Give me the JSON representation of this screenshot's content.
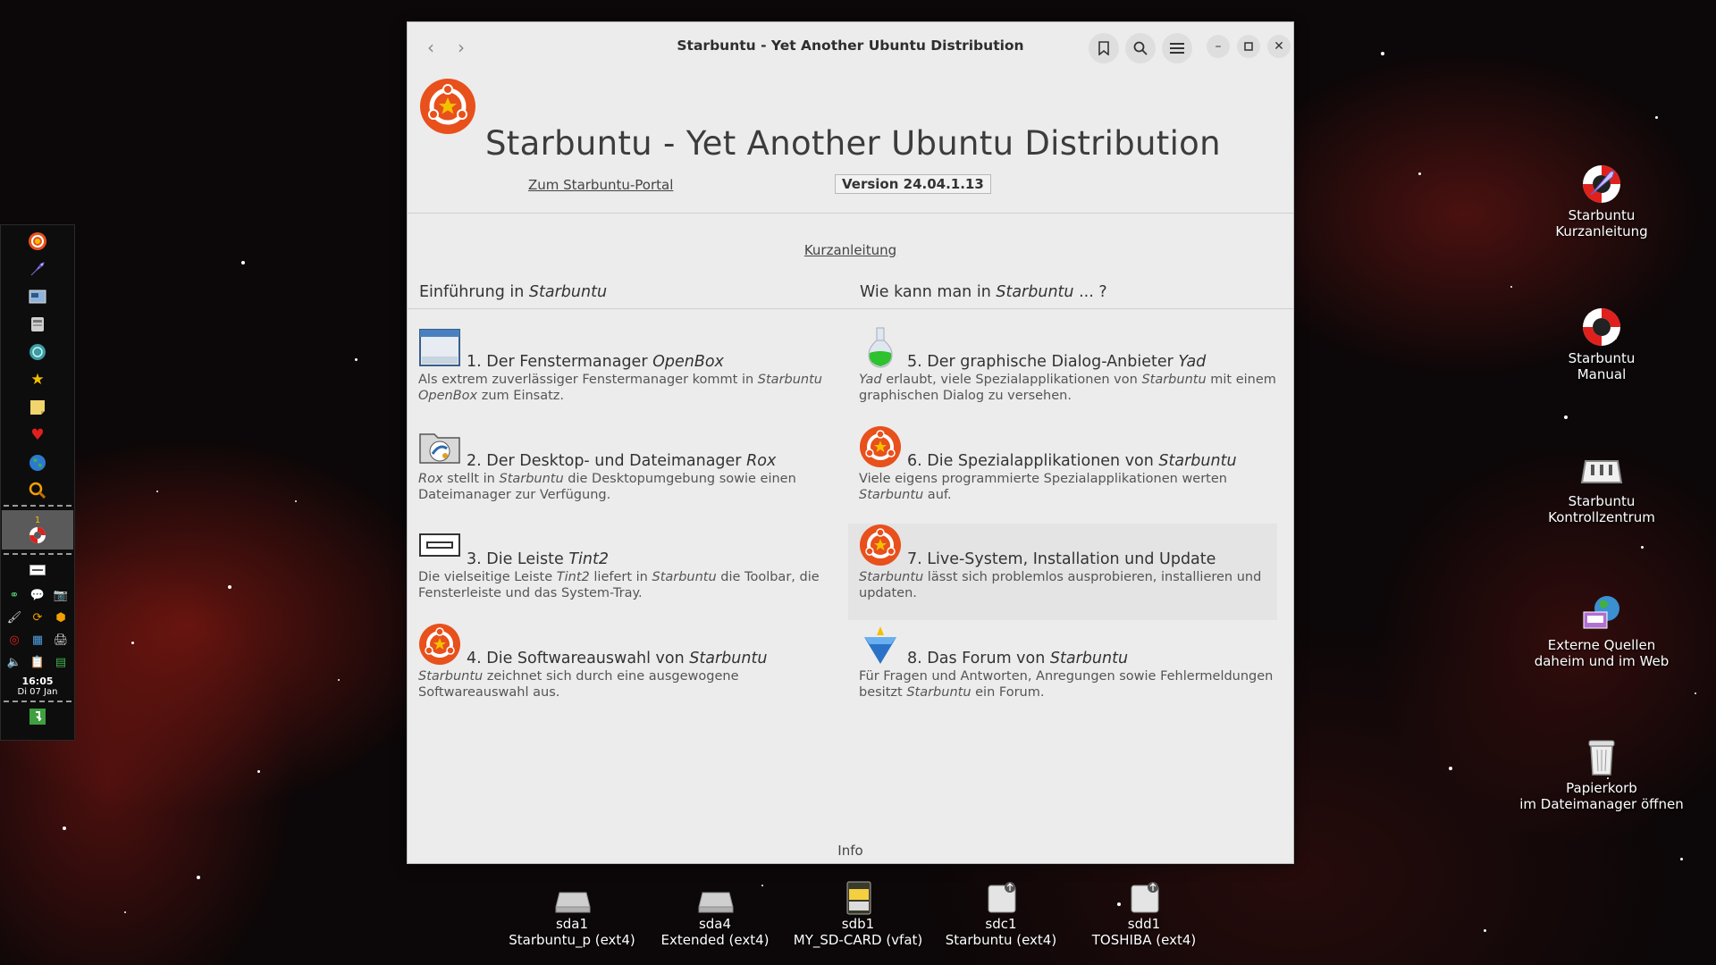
{
  "window": {
    "title": "Starbuntu - Yet Another Ubuntu Distribution",
    "main_title": "Starbuntu - Yet Another Ubuntu Distribution",
    "portal_link": "Zum Starbuntu-Portal",
    "version": "Version 24.04.1.13",
    "quick_guide": "Kurzanleitung",
    "col_left": {
      "pre": "Einführung in ",
      "em": "Starbuntu",
      "post": ""
    },
    "col_right": {
      "pre": "Wie kann man in ",
      "em": "Starbuntu",
      "post": " ... ?"
    },
    "info": "Info",
    "items": [
      {
        "icon": "window-icon",
        "title_pre": "1. Der Fenstermanager ",
        "title_em": "OpenBox",
        "title_post": "",
        "desc": [
          {
            "t": "Als extrem zuverlässiger Fenstermanager kommt in "
          },
          {
            "e": "Starbuntu OpenBox"
          },
          {
            "t": " zum Einsatz."
          }
        ]
      },
      {
        "icon": "flask-icon",
        "title_pre": "5. Der graphische Dialog-Anbieter ",
        "title_em": "Yad",
        "title_post": "",
        "desc": [
          {
            "e": "Yad"
          },
          {
            "t": " erlaubt, viele Spezialapplikationen von "
          },
          {
            "e": "Starbuntu"
          },
          {
            "t": " mit einem graphischen Dialog zu versehen."
          }
        ]
      },
      {
        "icon": "file-manager-icon",
        "title_pre": "2. Der Desktop- und Dateimanager ",
        "title_em": "Rox",
        "title_post": "",
        "desc": [
          {
            "e": "Rox"
          },
          {
            "t": " stellt in "
          },
          {
            "e": "Starbuntu"
          },
          {
            "t": " die Desktopumgebung sowie einen Dateimanager zur Verfügung."
          }
        ]
      },
      {
        "icon": "starbuntu-logo-icon",
        "title_pre": "6. Die Spezialapplikationen von ",
        "title_em": "Starbuntu",
        "title_post": "",
        "desc": [
          {
            "t": "Viele eigens programmierte Spezialapplikationen werten "
          },
          {
            "e": "Starbuntu"
          },
          {
            "t": " auf."
          }
        ]
      },
      {
        "icon": "panel-icon",
        "title_pre": "3. Die Leiste ",
        "title_em": "Tint2",
        "title_post": "",
        "desc": [
          {
            "t": "Die vielseitige Leiste "
          },
          {
            "e": "Tint2"
          },
          {
            "t": " liefert in "
          },
          {
            "e": "Starbuntu"
          },
          {
            "t": " die Toolbar, die Fensterleiste und das System-Tray."
          }
        ]
      },
      {
        "icon": "starbuntu-logo-icon",
        "title_pre": "7. Live-System, Installation und Update",
        "title_em": "",
        "title_post": "",
        "desc": [
          {
            "e": "Starbuntu"
          },
          {
            "t": " lässt sich problemlos ausprobieren, installieren und updaten."
          }
        ]
      },
      {
        "icon": "starbuntu-logo-icon",
        "title_pre": "4. Die Softwareauswahl von ",
        "title_em": "Starbuntu",
        "title_post": "",
        "desc": [
          {
            "e": "Starbuntu"
          },
          {
            "t": " zeichnet sich durch eine ausgewogene Softwareauswahl aus."
          }
        ]
      },
      {
        "icon": "forum-icon",
        "title_pre": "8. Das Forum von ",
        "title_em": "Starbuntu",
        "title_post": "",
        "desc": [
          {
            "t": "Für Fragen und Antworten, Anregungen sowie Fehlermeldungen besitzt "
          },
          {
            "e": "Starbuntu"
          },
          {
            "t": " ein Forum."
          }
        ]
      }
    ]
  },
  "panel": {
    "launchers": [
      "starbuntu-logo-icon",
      "rocket-icon",
      "screenshot-icon",
      "printer-icon",
      "globe-icon",
      "star-icon",
      "note-icon",
      "heart-icon",
      "earth-icon",
      "search-icon"
    ],
    "desktop_number": "1",
    "clock_time": "16:05",
    "clock_date": "Di 07 Jan"
  },
  "desktop_icons": [
    {
      "icon": "rocket-lifebuoy-icon",
      "line1": "Starbuntu",
      "line2": "Kurzanleitung"
    },
    {
      "icon": "lifebuoy-icon",
      "line1": "Starbuntu",
      "line2": "Manual"
    },
    {
      "icon": "control-center-icon",
      "line1": "Starbuntu",
      "line2": "Kontrollzentrum"
    },
    {
      "icon": "external-sources-icon",
      "line1": "Externe Quellen",
      "line2": "daheim und im Web"
    },
    {
      "icon": "trash-icon",
      "line1": "Papierkorb",
      "line2": "im Dateimanager öffnen"
    }
  ],
  "drives": [
    {
      "icon": "hdd-icon",
      "name": "sda1",
      "label": "Starbuntu_p (ext4)"
    },
    {
      "icon": "hdd-icon",
      "name": "sda4",
      "label": "Extended (ext4)"
    },
    {
      "icon": "sdcard-icon",
      "name": "sdb1",
      "label": "MY_SD-CARD (vfat)"
    },
    {
      "icon": "usb-drive-icon",
      "name": "sdc1",
      "label": "Starbuntu (ext4)"
    },
    {
      "icon": "usb-drive-icon",
      "name": "sdd1",
      "label": "TOSHIBA (ext4)"
    }
  ],
  "colors": {
    "accent": "#e8501c",
    "window_bg": "#ececec",
    "panel_bg": "#0d0d0d"
  }
}
